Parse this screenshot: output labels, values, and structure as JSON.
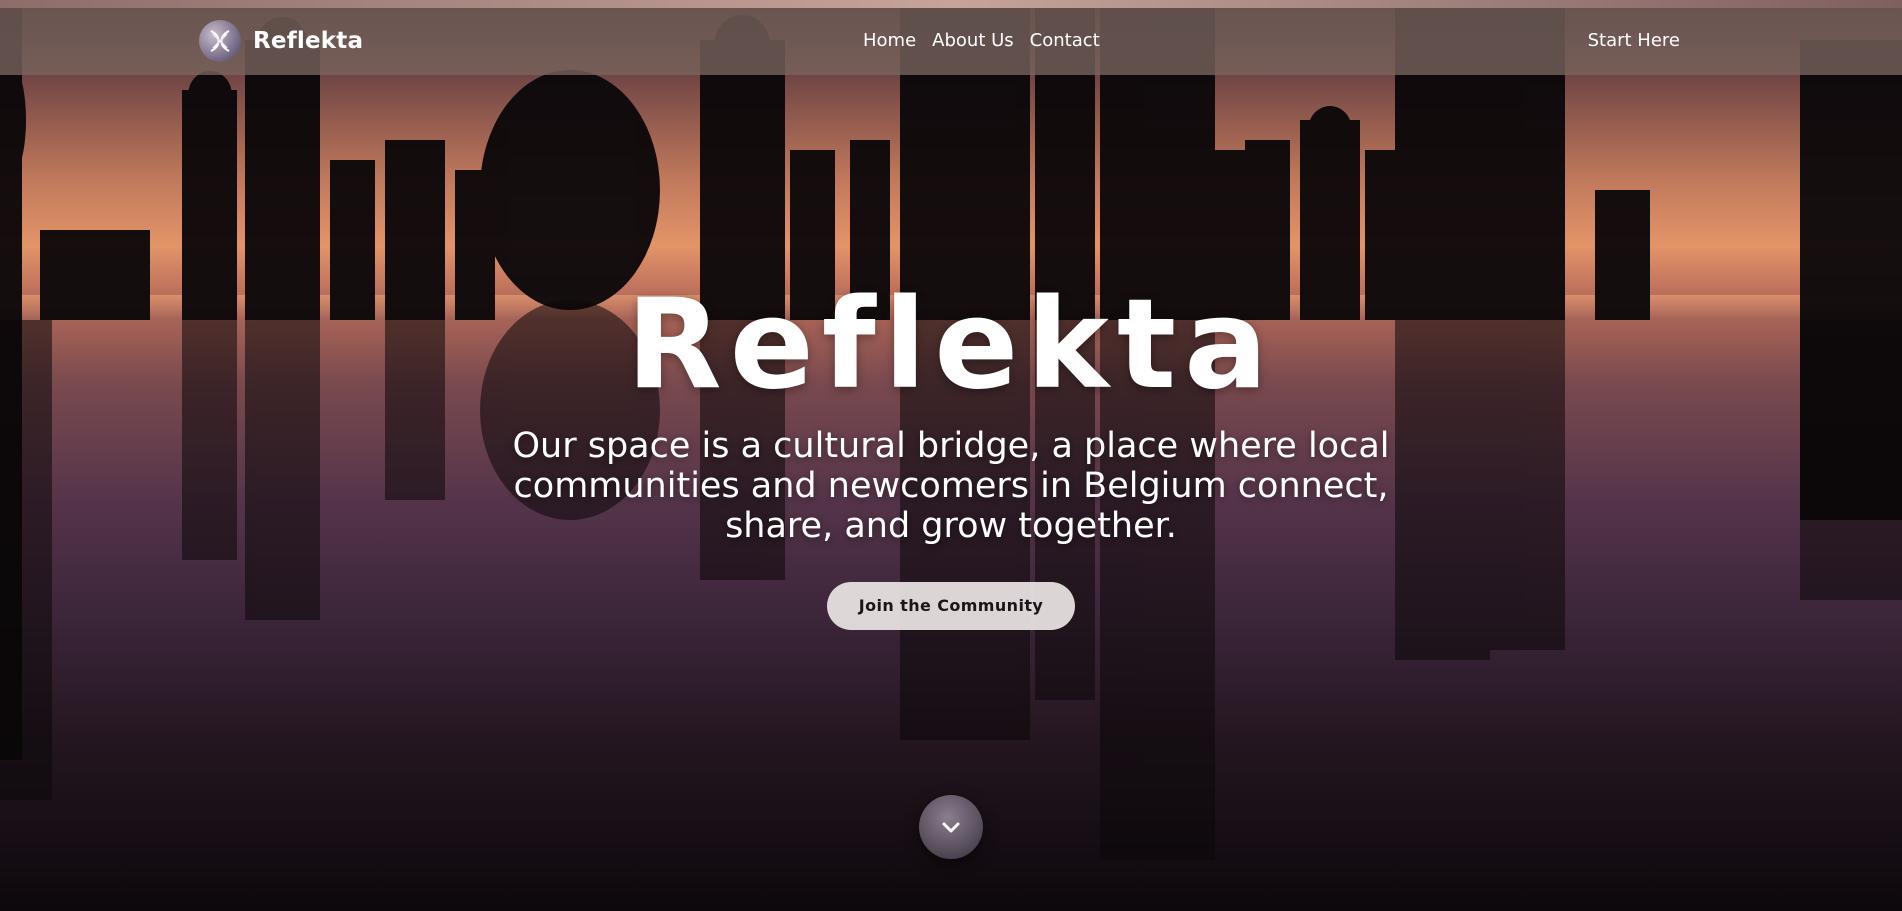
{
  "brand": {
    "name": "Reflekta",
    "logo_icon": "reflekta-logo-icon"
  },
  "nav": {
    "links": [
      "Home",
      "About Us",
      "Contact"
    ],
    "cta": "Start Here"
  },
  "hero": {
    "title": "Reflekta",
    "subtitle": "Our space is a cultural bridge, a place where local communities and newcomers in Belgium connect, share, and grow together.",
    "button": "Join the Community",
    "scroll_icon": "chevron-down-icon"
  },
  "colors": {
    "navbar": "#78645e",
    "button_bg": "#ece6e6",
    "button_text": "#1c1418",
    "text": "#ffffff"
  }
}
